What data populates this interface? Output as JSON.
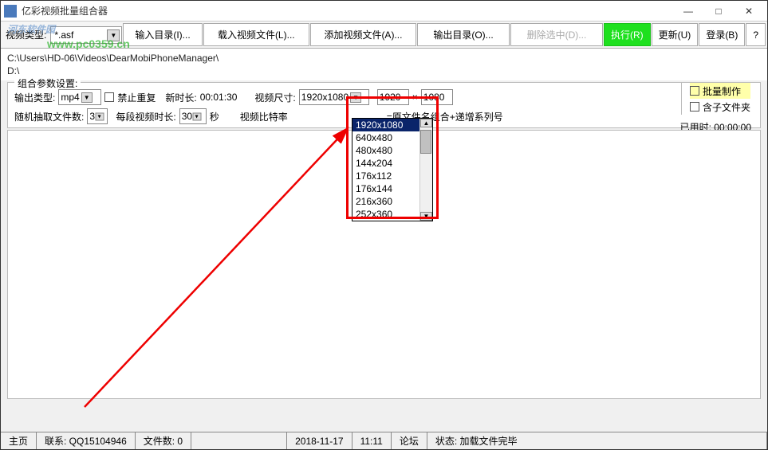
{
  "window": {
    "title": "亿彩视频批量组合器",
    "min": "—",
    "max": "□",
    "close": "✕"
  },
  "watermark": {
    "text": "河东软件园",
    "url": "www.pc0359.cn"
  },
  "toolbar": {
    "video_type_label": "视频类型:",
    "video_type_value": "*.asf",
    "import_dir": "输入目录(I)...",
    "load_files": "载入视频文件(L)...",
    "add_files": "添加视频文件(A)...",
    "output_dir": "输出目录(O)...",
    "delete_sel": "删除选中(D)...",
    "run": "执行(R)",
    "update": "更新(U)",
    "login": "登录(B)",
    "help": "?"
  },
  "paths": {
    "p1": "C:\\Users\\HD-06\\Videos\\DearMobiPhoneManager\\",
    "p2": "D:\\"
  },
  "group": {
    "title": "组合参数设置:",
    "out_type_label": "输出类型:",
    "out_type_value": "mp4",
    "no_repeat": "禁止重复",
    "new_len_label": "新时长:",
    "new_len_value": "00:01:30",
    "video_size_label": "视频尺寸:",
    "video_size_value": "1920x1080",
    "size_w": "1920",
    "size_x": "×",
    "size_h": "1080",
    "rand_count_label": "随机抽取文件数:",
    "rand_count_value": "3",
    "seg_len_label": "每段视频时长:",
    "seg_len_value": "30",
    "seg_len_unit": "秒",
    "bitrate_label": "视频比特率",
    "naming_label": "=原文件名组合+递增系列号",
    "batch_make": "批量制作",
    "include_sub": "含子文件夹"
  },
  "elapsed": {
    "label": "已用时:",
    "value": "00:00:00"
  },
  "dropdown": {
    "options": [
      "1920x1080",
      "640x480",
      "480x480",
      "144x204",
      "176x112",
      "176x144",
      "216x360",
      "252x360"
    ],
    "highlighted": 0
  },
  "status": {
    "home": "主页",
    "contact": "联系: QQ15104946",
    "files": "文件数: 0",
    "date": "2018-11-17",
    "time": "11:11",
    "forum": "论坛",
    "state": "状态: 加载文件完毕"
  }
}
